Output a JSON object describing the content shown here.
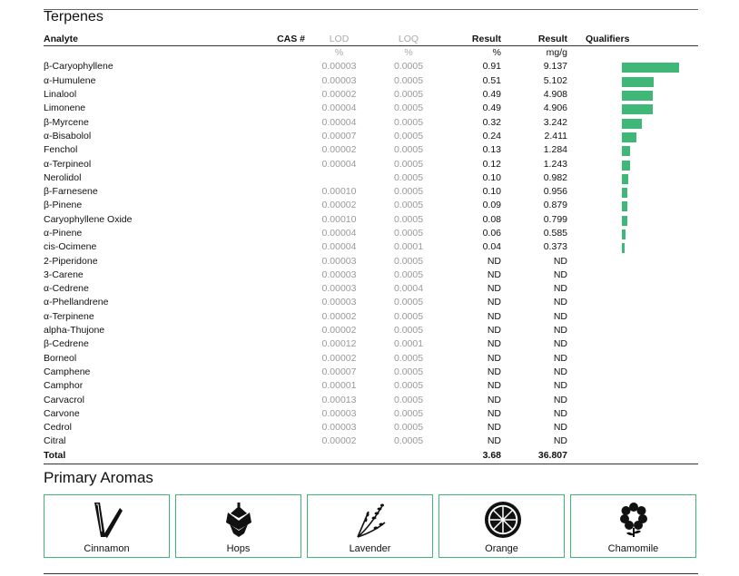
{
  "sections": {
    "terpenes_title": "Terpenes",
    "aromas_title": "Primary Aromas"
  },
  "columns": {
    "analyte": "Analyte",
    "cas": "CAS #",
    "lod": "LOD",
    "loq": "LOQ",
    "result_pct": "Result",
    "result_mg": "Result",
    "qualifiers": "Qualifiers"
  },
  "units": {
    "lod": "%",
    "loq": "%",
    "result_pct": "%",
    "result_mg": "mg/g"
  },
  "rows": [
    {
      "name": "β-Caryophyllene",
      "lod": "0.00003",
      "loq": "0.0005",
      "pct": "0.91",
      "mg": "9.137",
      "bar_fraction": 1.0
    },
    {
      "name": "α-Humulene",
      "lod": "0.00003",
      "loq": "0.0005",
      "pct": "0.51",
      "mg": "5.102",
      "bar_fraction": 0.56
    },
    {
      "name": "Linalool",
      "lod": "0.00002",
      "loq": "0.0005",
      "pct": "0.49",
      "mg": "4.908",
      "bar_fraction": 0.54
    },
    {
      "name": "Limonene",
      "lod": "0.00004",
      "loq": "0.0005",
      "pct": "0.49",
      "mg": "4.906",
      "bar_fraction": 0.54
    },
    {
      "name": "β-Myrcene",
      "lod": "0.00004",
      "loq": "0.0005",
      "pct": "0.32",
      "mg": "3.242",
      "bar_fraction": 0.35
    },
    {
      "name": "α-Bisabolol",
      "lod": "0.00007",
      "loq": "0.0005",
      "pct": "0.24",
      "mg": "2.411",
      "bar_fraction": 0.26
    },
    {
      "name": "Fenchol",
      "lod": "0.00002",
      "loq": "0.0005",
      "pct": "0.13",
      "mg": "1.284",
      "bar_fraction": 0.14
    },
    {
      "name": "α-Terpineol",
      "lod": "0.00004",
      "loq": "0.0005",
      "pct": "0.12",
      "mg": "1.243",
      "bar_fraction": 0.14
    },
    {
      "name": "Nerolidol",
      "lod": "",
      "loq": "0.0005",
      "pct": "0.10",
      "mg": "0.982",
      "bar_fraction": 0.11
    },
    {
      "name": "β-Farnesene",
      "lod": "0.00010",
      "loq": "0.0005",
      "pct": "0.10",
      "mg": "0.956",
      "bar_fraction": 0.1
    },
    {
      "name": "β-Pinene",
      "lod": "0.00002",
      "loq": "0.0005",
      "pct": "0.09",
      "mg": "0.879",
      "bar_fraction": 0.1
    },
    {
      "name": "Caryophyllene Oxide",
      "lod": "0.00010",
      "loq": "0.0005",
      "pct": "0.08",
      "mg": "0.799",
      "bar_fraction": 0.09
    },
    {
      "name": "α-Pinene",
      "lod": "0.00004",
      "loq": "0.0005",
      "pct": "0.06",
      "mg": "0.585",
      "bar_fraction": 0.065
    },
    {
      "name": "cis-Ocimene",
      "lod": "0.00004",
      "loq": "0.0001",
      "pct": "0.04",
      "mg": "0.373",
      "bar_fraction": 0.04
    },
    {
      "name": "2-Piperidone",
      "lod": "0.00003",
      "loq": "0.0005",
      "pct": "ND",
      "mg": "ND",
      "bar_fraction": 0
    },
    {
      "name": "3-Carene",
      "lod": "0.00003",
      "loq": "0.0005",
      "pct": "ND",
      "mg": "ND",
      "bar_fraction": 0
    },
    {
      "name": "α-Cedrene",
      "lod": "0.00003",
      "loq": "0.0004",
      "pct": "ND",
      "mg": "ND",
      "bar_fraction": 0
    },
    {
      "name": "α-Phellandrene",
      "lod": "0.00003",
      "loq": "0.0005",
      "pct": "ND",
      "mg": "ND",
      "bar_fraction": 0
    },
    {
      "name": "α-Terpinene",
      "lod": "0.00002",
      "loq": "0.0005",
      "pct": "ND",
      "mg": "ND",
      "bar_fraction": 0
    },
    {
      "name": "alpha-Thujone",
      "lod": "0.00002",
      "loq": "0.0005",
      "pct": "ND",
      "mg": "ND",
      "bar_fraction": 0
    },
    {
      "name": "β-Cedrene",
      "lod": "0.00012",
      "loq": "0.0001",
      "pct": "ND",
      "mg": "ND",
      "bar_fraction": 0
    },
    {
      "name": "Borneol",
      "lod": "0.00002",
      "loq": "0.0005",
      "pct": "ND",
      "mg": "ND",
      "bar_fraction": 0
    },
    {
      "name": "Camphene",
      "lod": "0.00007",
      "loq": "0.0005",
      "pct": "ND",
      "mg": "ND",
      "bar_fraction": 0
    },
    {
      "name": "Camphor",
      "lod": "0.00001",
      "loq": "0.0005",
      "pct": "ND",
      "mg": "ND",
      "bar_fraction": 0
    },
    {
      "name": "Carvacrol",
      "lod": "0.00013",
      "loq": "0.0005",
      "pct": "ND",
      "mg": "ND",
      "bar_fraction": 0
    },
    {
      "name": "Carvone",
      "lod": "0.00003",
      "loq": "0.0005",
      "pct": "ND",
      "mg": "ND",
      "bar_fraction": 0
    },
    {
      "name": "Cedrol",
      "lod": "0.00003",
      "loq": "0.0005",
      "pct": "ND",
      "mg": "ND",
      "bar_fraction": 0
    },
    {
      "name": "Citral",
      "lod": "0.00002",
      "loq": "0.0005",
      "pct": "ND",
      "mg": "ND",
      "bar_fraction": 0
    }
  ],
  "total": {
    "label": "Total",
    "pct": "3.68",
    "mg": "36.807"
  },
  "aromas": [
    {
      "label": "Cinnamon",
      "icon": "cinnamon-icon"
    },
    {
      "label": "Hops",
      "icon": "hops-icon"
    },
    {
      "label": "Lavender",
      "icon": "lavender-icon"
    },
    {
      "label": "Orange",
      "icon": "orange-icon"
    },
    {
      "label": "Chamomile",
      "icon": "chamomile-icon"
    }
  ],
  "colors": {
    "bar": "#3fb877",
    "box_border": "#3fb877",
    "muted": "#999999"
  }
}
